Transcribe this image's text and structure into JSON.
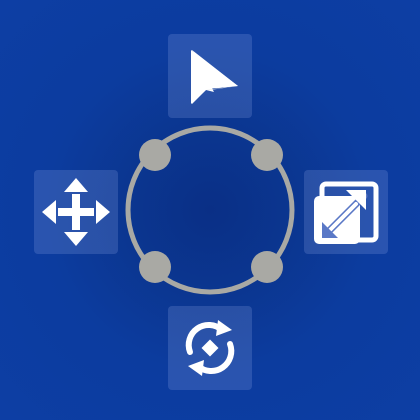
{
  "toolbar": {
    "tools": [
      {
        "id": "select",
        "icon": "cursor-arrow-icon"
      },
      {
        "id": "move",
        "icon": "move-arrows-icon"
      },
      {
        "id": "scale",
        "icon": "resize-diagonal-icon"
      },
      {
        "id": "rotate",
        "icon": "rotate-cycle-icon"
      }
    ]
  },
  "gizmo": {
    "handles": [
      "top-left",
      "top-right",
      "bottom-left",
      "bottom-right"
    ]
  },
  "colors": {
    "background": "#0b3a9e",
    "tool_tile": "#5a78c6",
    "icon": "#ffffff",
    "gizmo": "#a9a9a4"
  }
}
